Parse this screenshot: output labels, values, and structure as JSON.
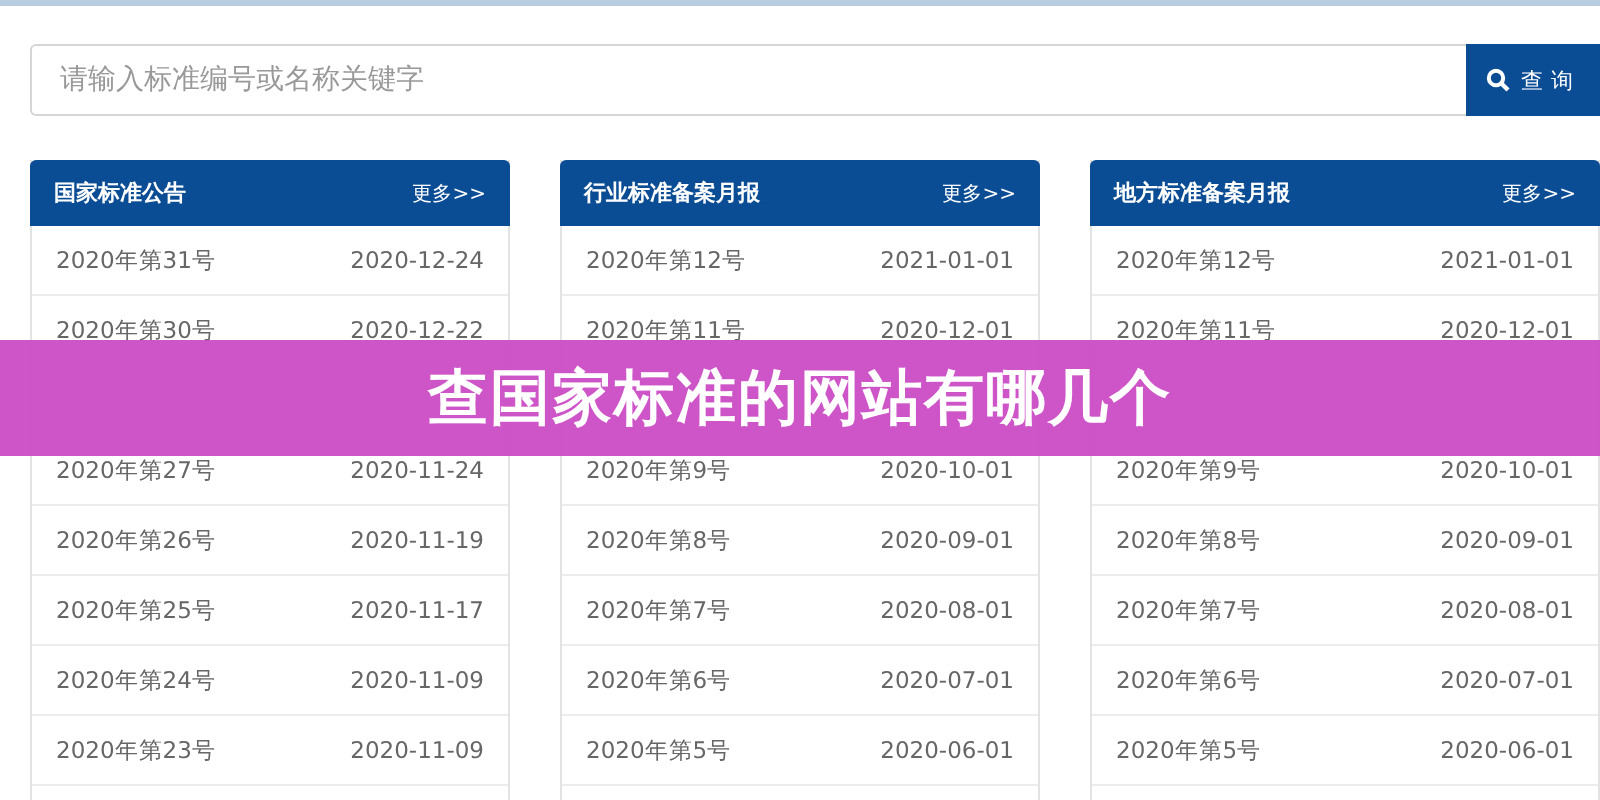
{
  "search": {
    "placeholder": "请输入标准编号或名称关键字",
    "button": "查询"
  },
  "panels": [
    {
      "title": "国家标准公告",
      "more": "更多>>",
      "rows": [
        {
          "label": "2020年第31号",
          "date": "2020-12-24"
        },
        {
          "label": "2020年第30号",
          "date": "2020-12-22"
        },
        {},
        {
          "label": "2020年第27号",
          "date": "2020-11-24"
        },
        {
          "label": "2020年第26号",
          "date": "2020-11-19"
        },
        {
          "label": "2020年第25号",
          "date": "2020-11-17"
        },
        {
          "label": "2020年第24号",
          "date": "2020-11-09"
        },
        {
          "label": "2020年第23号",
          "date": "2020-11-09"
        }
      ]
    },
    {
      "title": "行业标准备案月报",
      "more": "更多>>",
      "rows": [
        {
          "label": "2020年第12号",
          "date": "2021-01-01"
        },
        {
          "label": "2020年第11号",
          "date": "2020-12-01"
        },
        {},
        {
          "label": "2020年第9号",
          "date": "2020-10-01"
        },
        {
          "label": "2020年第8号",
          "date": "2020-09-01"
        },
        {
          "label": "2020年第7号",
          "date": "2020-08-01"
        },
        {
          "label": "2020年第6号",
          "date": "2020-07-01"
        },
        {
          "label": "2020年第5号",
          "date": "2020-06-01"
        }
      ]
    },
    {
      "title": "地方标准备案月报",
      "more": "更多>>",
      "rows": [
        {
          "label": "2020年第12号",
          "date": "2021-01-01"
        },
        {
          "label": "2020年第11号",
          "date": "2020-12-01"
        },
        {},
        {
          "label": "2020年第9号",
          "date": "2020-10-01"
        },
        {
          "label": "2020年第8号",
          "date": "2020-09-01"
        },
        {
          "label": "2020年第7号",
          "date": "2020-08-01"
        },
        {
          "label": "2020年第6号",
          "date": "2020-07-01"
        },
        {
          "label": "2020年第5号",
          "date": "2020-06-01"
        }
      ]
    }
  ],
  "banner": {
    "title": "查国家标准的网站有哪几个"
  }
}
